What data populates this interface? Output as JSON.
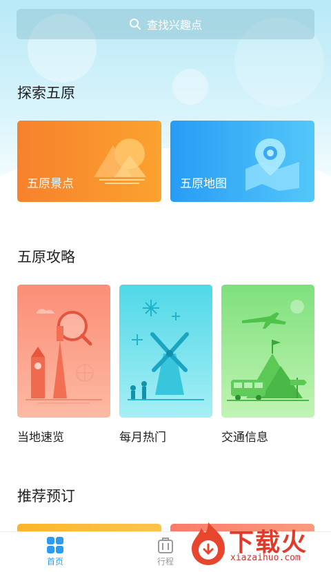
{
  "search": {
    "placeholder": "查找兴趣点"
  },
  "sections": {
    "explore": {
      "title": "探索五原"
    },
    "guide": {
      "title": "五原攻略"
    },
    "recommend": {
      "title": "推荐预订"
    }
  },
  "explore_cards": [
    {
      "label": "五原景点",
      "icon": "mountain-sun-icon",
      "color": "#f7812c"
    },
    {
      "label": "五原地图",
      "icon": "map-pin-icon",
      "color": "#279cf5"
    }
  ],
  "guide_cards": [
    {
      "label": "当地速览",
      "icon": "landmarks-magnifier-illustration"
    },
    {
      "label": "每月热门",
      "icon": "windmill-fireworks-illustration"
    },
    {
      "label": "交通信息",
      "icon": "bus-mountain-plane-illustration"
    }
  ],
  "bottom_nav": [
    {
      "label": "首页",
      "icon": "grid-icon",
      "active": true,
      "color": "#2d9cf0"
    },
    {
      "label": "行程",
      "icon": "suitcase-icon",
      "active": false,
      "color": "#999999"
    }
  ],
  "watermark": {
    "text": "下载火",
    "url": "xiazaihuo.com"
  }
}
